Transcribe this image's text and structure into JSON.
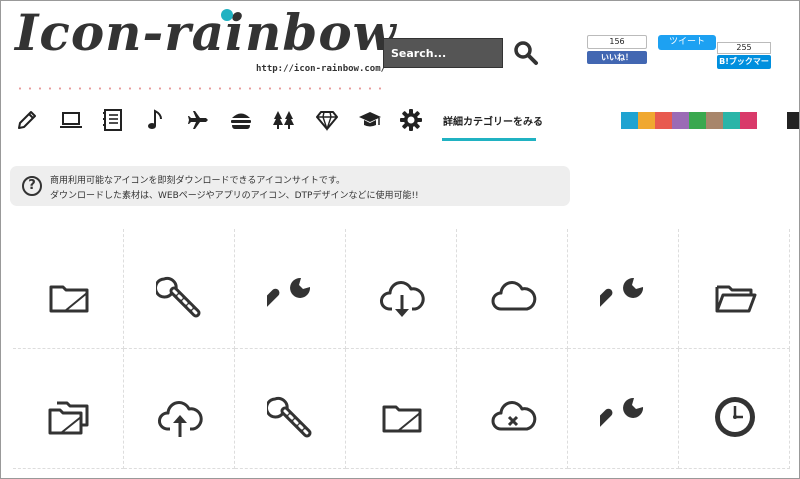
{
  "site": {
    "logo": "Icon-rainbow",
    "url": "http://icon-rainbow.com/"
  },
  "search": {
    "placeholder": "Search..."
  },
  "social": {
    "facebook": {
      "count": "156",
      "label": "いいね！"
    },
    "twitter": {
      "label": "ツイート"
    },
    "hatena": {
      "count": "255",
      "label": "B!ブックマーク"
    }
  },
  "categories": {
    "icons": [
      "pencil-icon",
      "laptop-icon",
      "notebook-icon",
      "music-note-icon",
      "airplane-icon",
      "hamburger-icon",
      "trees-icon",
      "diamond-icon",
      "graduation-cap-icon",
      "gear-icon"
    ],
    "more_link": "詳細カテゴリーをみる"
  },
  "color_swatches": [
    "#1fa3d1",
    "#f0a830",
    "#e85a4f",
    "#9b6bb5",
    "#3aa84f",
    "#a8866b",
    "#2ab5a8",
    "#d93a6a"
  ],
  "info": {
    "line1": "商用利用可能なアイコンを即刻ダウンロードできるアイコンサイトです。",
    "line2": "ダウンロードした素材は、WEBページやアプリのアイコン、DTPデザインなどに使用可能!!"
  },
  "icon_grid": [
    "folder-icon",
    "adjustable-wrench-icon",
    "wrench-icon",
    "cloud-download-icon",
    "cloud-icon",
    "wrench-icon",
    "open-folder-icon",
    "folders-icon",
    "cloud-upload-icon",
    "adjustable-wrench-icon",
    "folder-icon",
    "cloud-error-icon",
    "wrench-icon",
    "clock-icon"
  ]
}
